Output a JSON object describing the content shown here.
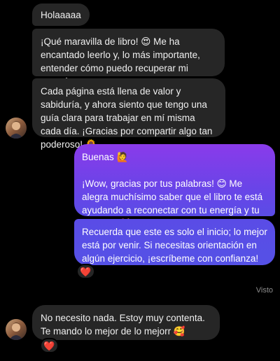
{
  "messages": {
    "incoming": [
      {
        "text": "Holaaaaa"
      },
      {
        "text": "¡Qué maravilla de libro! 😍 Me ha encantado leerlo y, lo más importante, entender cómo puedo recuperar mi energía poco a poco."
      },
      {
        "text": "Cada página está llena de valor y sabiduría, y ahora siento que tengo una guía clara para trabajar en mí misma cada día. ¡Gracias por compartir algo tan poderoso! 🌻"
      },
      {
        "text": "No necesito nada. Estoy muy contenta. Te mando lo mejor de lo mejorr 🥰"
      }
    ],
    "outgoing": [
      {
        "text": "Buenas 🙋\n\n¡Wow, gracias por tus palabras! 😊 Me alegra muchísimo saber que el libro te está ayudando a reconectar con tu energía y tu esencia. 💖"
      },
      {
        "text": "Recuerda que este es solo el inicio; lo mejor está por venir. Si necesitas orientación en algún ejercicio, ¡escríbeme con confianza! 🙌"
      }
    ]
  },
  "reactions": [
    "❤️",
    "❤️"
  ],
  "status": {
    "seen_label": "Visto"
  },
  "colors": {
    "background": "#000000",
    "incoming_bubble": "#262626",
    "outgoing_top": "#8a3bea",
    "outgoing_bottom": "#5551e6",
    "seen_text": "#8e8e8e"
  },
  "icons": {
    "avatar": "avatar-image",
    "reaction": "heart-icon"
  }
}
